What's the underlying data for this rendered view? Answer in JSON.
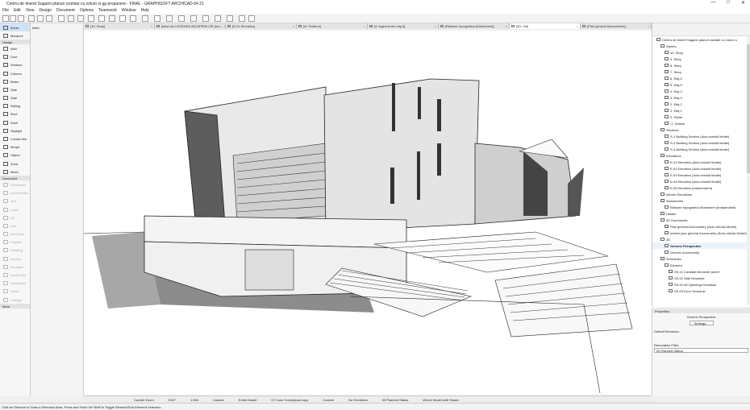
{
  "window": {
    "title": "Centru de tineret Sagarin planuri cizelate cu volum si gg propunere - FINAL - GRAPHISOFT ARCHICAD-64 21",
    "min": "—",
    "max": "□",
    "close": "✕"
  },
  "menu": [
    "File",
    "Edit",
    "View",
    "Design",
    "Document",
    "Options",
    "Teamwork",
    "Window",
    "Help"
  ],
  "tabs": [
    {
      "label": "[10. Story]",
      "active": false
    },
    {
      "label": "[tabel etc LEGENDA INCAPERILOR (Ind...",
      "active": false
    },
    {
      "label": "[E-01 Elevation]",
      "active": false
    },
    {
      "label": "[ef. Parterul]",
      "active": false
    },
    {
      "label": "[4. legenda etc etaj 4]",
      "active": false
    },
    {
      "label": "[Ridicare topografica (Worksheet)]",
      "active": false
    },
    {
      "label": "[3D / All]",
      "active": true
    },
    {
      "label": "[Plan general Axonometric]",
      "active": false
    }
  ],
  "toolbox": {
    "arrow": "Arrow",
    "marquee": "Marquee",
    "main": "Main",
    "design_header": "Design",
    "design_tools": [
      "Wall",
      "Door",
      "Window",
      "Column",
      "Beam",
      "Slab",
      "Stair",
      "Railing",
      "Roof",
      "Shell",
      "Skylight",
      "Curtain Wa",
      "Morph",
      "Object",
      "Zone",
      "Mesh"
    ],
    "document_header": "Document",
    "document_tools": [
      "Dimension",
      "Level Dimen",
      "Text",
      "Label",
      "Fill",
      "Line",
      "Arc/Circle",
      "Polyline",
      "Drawing",
      "Section",
      "Elevation",
      "Interior Ele",
      "Worksheet",
      "Detail",
      "Change"
    ],
    "more_header": "More"
  },
  "navigator": {
    "items": [
      {
        "label": "Centru de tineret Sagarin planuri cizelate cu volum s",
        "indent": 1
      },
      {
        "label": "Stories",
        "indent": 2
      },
      {
        "label": "10. Story",
        "indent": 3
      },
      {
        "label": "9. Story",
        "indent": 3
      },
      {
        "label": "8. Story",
        "indent": 3
      },
      {
        "label": "7. Story",
        "indent": 3
      },
      {
        "label": "6. Etaj 6",
        "indent": 3
      },
      {
        "label": "5. Etaj 5",
        "indent": 3
      },
      {
        "label": "4. Etaj 4",
        "indent": 3
      },
      {
        "label": "3. Etaj 3",
        "indent": 3
      },
      {
        "label": "2. Etaj 2",
        "indent": 3
      },
      {
        "label": "1. Etaj 1",
        "indent": 3
      },
      {
        "label": "0. Parter",
        "indent": 3
      },
      {
        "label": "-1. Subsol",
        "indent": 3
      },
      {
        "label": "Sections",
        "indent": 2
      },
      {
        "label": "S-1 Building Section (Auto-rebuild Model)",
        "indent": 3
      },
      {
        "label": "S-2 Building Section (Auto-rebuild Model)",
        "indent": 3
      },
      {
        "label": "S-3 Building Section (Auto-rebuild Model)",
        "indent": 3
      },
      {
        "label": "Elevations",
        "indent": 2
      },
      {
        "label": "E-01 Elevation (Auto-rebuild Model)",
        "indent": 3
      },
      {
        "label": "E-02 Elevation (Auto-rebuild Model)",
        "indent": 3
      },
      {
        "label": "E-03 Elevation (Auto-rebuild Model)",
        "indent": 3
      },
      {
        "label": "E-04 Elevation (Auto-rebuild Model)",
        "indent": 3
      },
      {
        "label": "E-05 Elevation (Independent)",
        "indent": 3
      },
      {
        "label": "Interior Elevations",
        "indent": 2
      },
      {
        "label": "Worksheets",
        "indent": 2
      },
      {
        "label": "Ridicare topografica Worksheet (Independent)",
        "indent": 3
      },
      {
        "label": "Details",
        "indent": 2
      },
      {
        "label": "3D Documents",
        "indent": 2
      },
      {
        "label": "Plan general Axonometry (Auto-rebuild Model)",
        "indent": 3
      },
      {
        "label": "Imbine plan general Axonometry (Auto-rebuild Model)",
        "indent": 3
      },
      {
        "label": "3D",
        "indent": 2
      },
      {
        "label": "Generic Perspective",
        "indent": 3,
        "bold": true
      },
      {
        "label": "Generic Axonometry",
        "indent": 3
      },
      {
        "label": "Schedules",
        "indent": 2
      },
      {
        "label": "Element",
        "indent": 3
      },
      {
        "label": "SS-01 Cantitati elemente pereti",
        "indent": 4
      },
      {
        "label": "SS-01 Wall Schedule",
        "indent": 4
      },
      {
        "label": "SS-02 All Openings Schedule",
        "indent": 4
      },
      {
        "label": "SS-03 Door Schedule",
        "indent": 4
      }
    ]
  },
  "properties": {
    "header": "Properties",
    "value": "Generic Perspective",
    "settings": "Settings...",
    "default_elements": "Default Elements:",
    "renovation_filter": "Renovation Filter:",
    "renovation_value": "05 Planned Status"
  },
  "viewbar": [
    "Current Zoom",
    "5.00°",
    "1:500",
    "Custom",
    "Entire Model",
    "07 Color Conceptual copy",
    "Custom",
    "No Overrides",
    "05 Planned Status",
    "Whole Model with Shado"
  ],
  "status": "Click an Element or Draw a Selection Area. Press and Hold Ctrl+Shift to Toggle Element/Sub-Element Selection."
}
